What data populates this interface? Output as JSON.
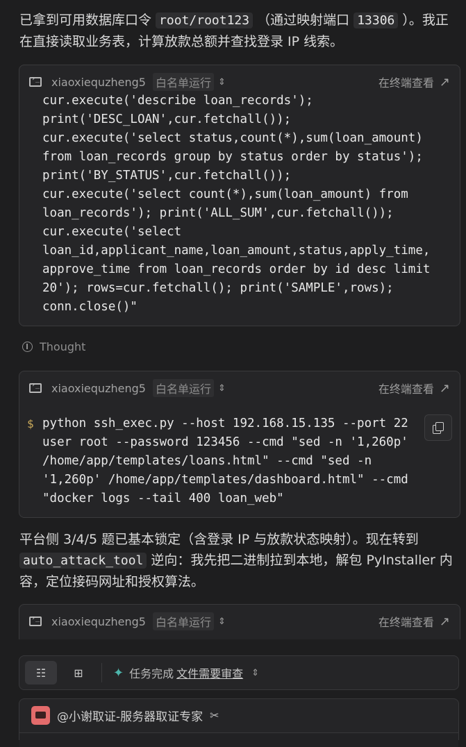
{
  "intro": {
    "before": "已拿到可用数据库口令 ",
    "cred": "root/root123",
    "mid": " （通过映射端口 ",
    "port": "13306",
    "after": " ）。我正在直接读取业务表，计算放款总额并查找登录 IP 线索。"
  },
  "card1": {
    "host": "xiaoxiequzheng5",
    "badge": "白名单运行",
    "open_terminal": "在终端查看",
    "code_lines": [
      "cur.execute('describe loan_records');",
      "print('DESC_LOAN',cur.fetchall());",
      "cur.execute('select status,count(*),sum(loan_amount)",
      "from loan_records group by status order by status');",
      "print('BY_STATUS',cur.fetchall());",
      "cur.execute('select count(*),sum(loan_amount) from",
      "loan_records'); print('ALL_SUM',cur.fetchall());",
      "cur.execute('select",
      "loan_id,applicant_name,loan_amount,status,apply_time,",
      "approve_time from loan_records order by id desc limit",
      "20'); rows=cur.fetchall(); print('SAMPLE',rows);",
      "conn.close()\""
    ]
  },
  "thought": {
    "label": "Thought"
  },
  "card2": {
    "host": "xiaoxiequzheng5",
    "badge": "白名单运行",
    "open_terminal": "在终端查看",
    "prompt": "$",
    "code_lines": [
      "python ssh_exec.py --host 192.168.15.135 --port 22",
      "user root --password 123456 --cmd \"sed -n '1,260p'",
      "/home/app/templates/loans.html\" --cmd \"sed -n",
      "'1,260p' /home/app/templates/dashboard.html\" --cmd",
      "\"docker logs --tail 400 loan_web\""
    ]
  },
  "para2": {
    "before": "平台侧 3/4/5 题已基本锁定（含登录 IP 与放款状态映射）。现在转到 ",
    "tool": "auto_attack_tool",
    "after": " 逆向：我先把二进制拉到本地，解包 PyInstaller 内容，定位接码网址和授权算法。"
  },
  "card3": {
    "host": "xiaoxiequzheng5",
    "badge": "白名单运行",
    "open_terminal": "在终端查看"
  },
  "toolbar": {
    "status": "任务完成",
    "review": "文件需要审查"
  },
  "agent": {
    "name": "@小谢取证-服务器取证专家"
  },
  "icons": {
    "terminal": "terminal-icon",
    "thought": "thought-icon",
    "copy": "copy-icon",
    "tools": "tools-icon"
  }
}
